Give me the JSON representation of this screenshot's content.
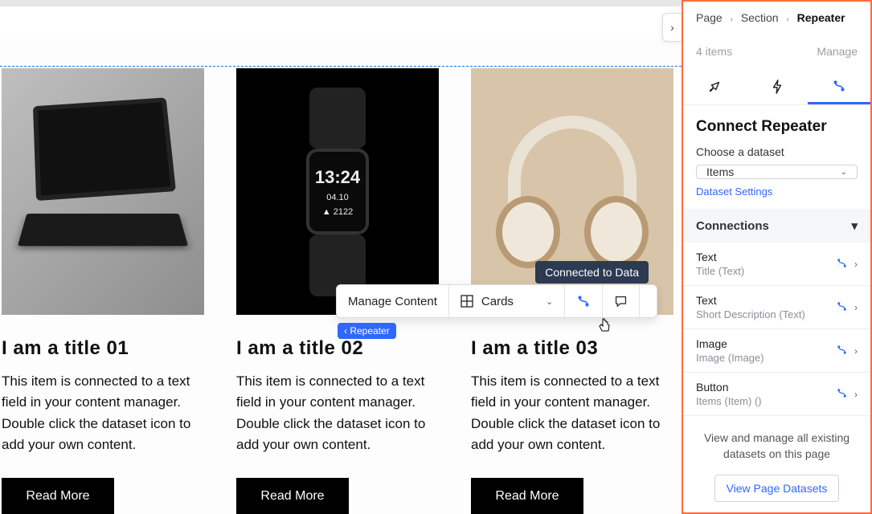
{
  "breadcrumb": {
    "page": "Page",
    "section": "Section",
    "current": "Repeater"
  },
  "meta": {
    "count": "4 items",
    "manage": "Manage"
  },
  "panel": {
    "title": "Connect Repeater",
    "choose_label": "Choose a dataset",
    "dataset_selected": "Items",
    "dataset_settings": "Dataset Settings",
    "connections_header": "Connections",
    "footer_text": "View and manage all existing datasets on this page",
    "view_datasets_btn": "View Page Datasets"
  },
  "connections": [
    {
      "type": "Text",
      "binding": "Title (Text)"
    },
    {
      "type": "Text",
      "binding": "Short Description (Text)"
    },
    {
      "type": "Image",
      "binding": "Image (Image)"
    },
    {
      "type": "Button",
      "binding": "Items (Item) ()"
    }
  ],
  "toolbar": {
    "manage_content": "Manage Content",
    "layout_label": "Cards",
    "tooltip": "Connected to Data",
    "repeater_badge": "Repeater"
  },
  "watch": {
    "time": "13:24",
    "date": "04.10",
    "steps": "▲ 2122"
  },
  "cards": [
    {
      "title": "I am a title 01",
      "desc": "This item is connected to a text field in your content manager. Double click the dataset icon to add your own content.",
      "btn": "Read More"
    },
    {
      "title": "I am a title 02",
      "desc": "This item is connected to a text field in your content manager. Double click the dataset icon to add your own content.",
      "btn": "Read More"
    },
    {
      "title": "I am a title 03",
      "desc": "This item is connected to a text field in your content manager. Double click the dataset icon to add your own content.",
      "btn": "Read More"
    }
  ]
}
